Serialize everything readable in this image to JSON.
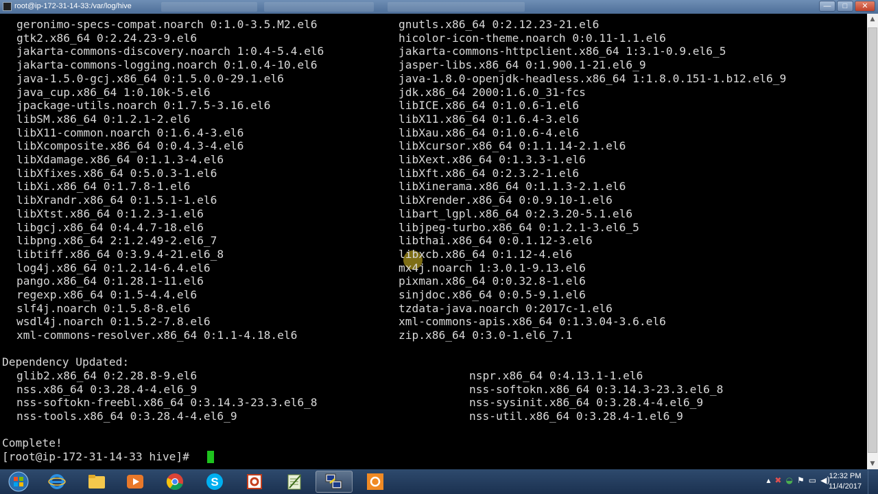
{
  "window": {
    "title": "root@ip-172-31-14-33:/var/log/hive",
    "buttons": {
      "minimize": "—",
      "maximize": "□",
      "close": "✕"
    }
  },
  "terminal": {
    "installed_left": [
      "geronimo-specs-compat.noarch 0:1.0-3.5.M2.el6",
      "gtk2.x86_64 0:2.24.23-9.el6",
      "jakarta-commons-discovery.noarch 1:0.4-5.4.el6",
      "jakarta-commons-logging.noarch 0:1.0.4-10.el6",
      "java-1.5.0-gcj.x86_64 0:1.5.0.0-29.1.el6",
      "java_cup.x86_64 1:0.10k-5.el6",
      "jpackage-utils.noarch 0:1.7.5-3.16.el6",
      "libSM.x86_64 0:1.2.1-2.el6",
      "libX11-common.noarch 0:1.6.4-3.el6",
      "libXcomposite.x86_64 0:0.4.3-4.el6",
      "libXdamage.x86_64 0:1.1.3-4.el6",
      "libXfixes.x86_64 0:5.0.3-1.el6",
      "libXi.x86_64 0:1.7.8-1.el6",
      "libXrandr.x86_64 0:1.5.1-1.el6",
      "libXtst.x86_64 0:1.2.3-1.el6",
      "libgcj.x86_64 0:4.4.7-18.el6",
      "libpng.x86_64 2:1.2.49-2.el6_7",
      "libtiff.x86_64 0:3.9.4-21.el6_8",
      "log4j.x86_64 0:1.2.14-6.4.el6",
      "pango.x86_64 0:1.28.1-11.el6",
      "regexp.x86_64 0:1.5-4.4.el6",
      "slf4j.noarch 0:1.5.8-8.el6",
      "wsdl4j.noarch 0:1.5.2-7.8.el6",
      "xml-commons-resolver.x86_64 0:1.1-4.18.el6"
    ],
    "installed_right": [
      "gnutls.x86_64 0:2.12.23-21.el6",
      "hicolor-icon-theme.noarch 0:0.11-1.1.el6",
      "jakarta-commons-httpclient.x86_64 1:3.1-0.9.el6_5",
      "jasper-libs.x86_64 0:1.900.1-21.el6_9",
      "java-1.8.0-openjdk-headless.x86_64 1:1.8.0.151-1.b12.el6_9",
      "jdk.x86_64 2000:1.6.0_31-fcs",
      "libICE.x86_64 0:1.0.6-1.el6",
      "libX11.x86_64 0:1.6.4-3.el6",
      "libXau.x86_64 0:1.0.6-4.el6",
      "libXcursor.x86_64 0:1.1.14-2.1.el6",
      "libXext.x86_64 0:1.3.3-1.el6",
      "libXft.x86_64 0:2.3.2-1.el6",
      "libXinerama.x86_64 0:1.1.3-2.1.el6",
      "libXrender.x86_64 0:0.9.10-1.el6",
      "libart_lgpl.x86_64 0:2.3.20-5.1.el6",
      "libjpeg-turbo.x86_64 0:1.2.1-3.el6_5",
      "libthai.x86_64 0:0.1.12-3.el6",
      "libxcb.x86_64 0:1.12-4.el6",
      "mx4j.noarch 1:3.0.1-9.13.el6",
      "pixman.x86_64 0:0.32.8-1.el6",
      "sinjdoc.x86_64 0:0.5-9.1.el6",
      "tzdata-java.noarch 0:2017c-1.el6",
      "xml-commons-apis.x86_64 0:1.3.04-3.6.el6",
      "zip.x86_64 0:3.0-1.el6_7.1"
    ],
    "dependency_header": "Dependency Updated:",
    "updated_left": [
      "glib2.x86_64 0:2.28.8-9.el6",
      "nss.x86_64 0:3.28.4-4.el6_9",
      "nss-softokn-freebl.x86_64 0:3.14.3-23.3.el6_8",
      "nss-tools.x86_64 0:3.28.4-4.el6_9"
    ],
    "updated_right": [
      "nspr.x86_64 0:4.13.1-1.el6",
      "nss-softokn.x86_64 0:3.14.3-23.3.el6_8",
      "nss-sysinit.x86_64 0:3.28.4-4.el6_9",
      "nss-util.x86_64 0:3.28.4-1.el6_9"
    ],
    "complete": "Complete!",
    "prompt": "[root@ip-172-31-14-33 hive]# ",
    "cursor_color": "#1ec31e"
  },
  "taskbar": {
    "apps": [
      "windows-start",
      "internet-explorer",
      "file-explorer",
      "media-player",
      "chrome",
      "skype",
      "office-presentation",
      "notepad-editor",
      "putty",
      "recorder"
    ],
    "clock_time": "12:32 PM",
    "clock_date": "11/4/2017"
  }
}
